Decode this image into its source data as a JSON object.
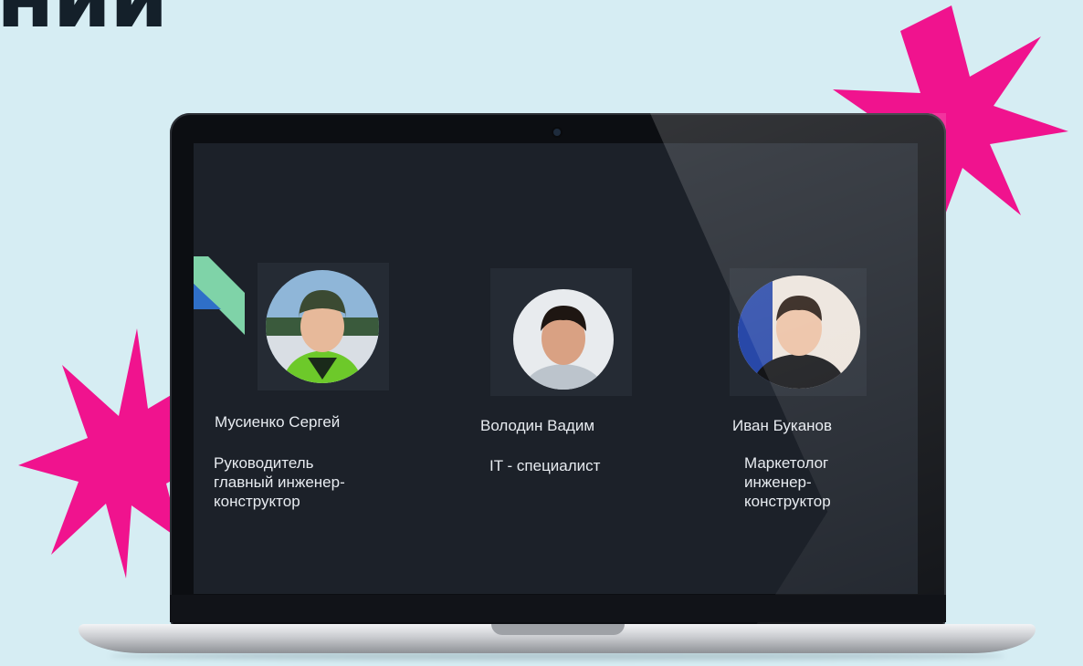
{
  "headline": "нии",
  "team": [
    {
      "name": "Мусиенко Сергей",
      "role_lines": [
        "Руководитель",
        "главный инженер-",
        "конструктор"
      ],
      "avatar": "person-photo"
    },
    {
      "name": "Володин Вадим",
      "role_lines": [
        "IT - специалист"
      ],
      "avatar": "person-photo"
    },
    {
      "name": "Иван Буканов",
      "role_lines": [
        "Маркетолог",
        "инженер-",
        "конструктор"
      ],
      "avatar": "person-photo"
    }
  ],
  "colors": {
    "background": "#d6edf3",
    "burst": "#f0138e",
    "screen": "#1c2129",
    "logo_green": "#7fd3a8",
    "logo_blue": "#2f6fc8"
  }
}
